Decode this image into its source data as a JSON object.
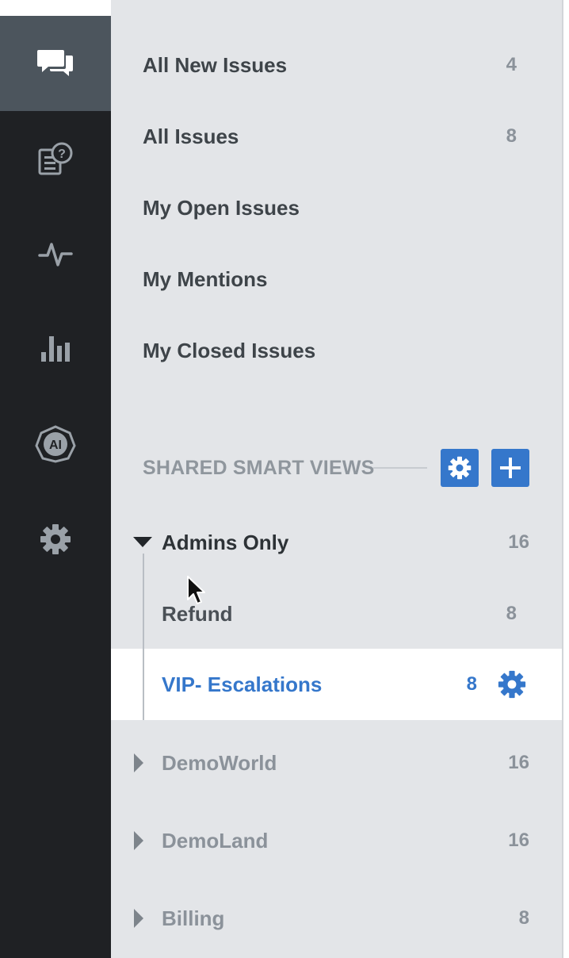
{
  "rail": {
    "items": [
      {
        "icon": "chat-bubbles-icon",
        "active": true
      },
      {
        "icon": "help-articles-icon",
        "active": false
      },
      {
        "icon": "activity-pulse-icon",
        "active": false
      },
      {
        "icon": "bar-chart-icon",
        "active": false
      },
      {
        "icon": "ai-badge-icon",
        "label": "AI",
        "active": false
      },
      {
        "icon": "gear-icon",
        "active": false
      }
    ]
  },
  "views": [
    {
      "label": "All New Issues",
      "count": "4"
    },
    {
      "label": "All Issues",
      "count": "8"
    },
    {
      "label": "My Open Issues",
      "count": ""
    },
    {
      "label": "My Mentions",
      "count": ""
    },
    {
      "label": "My Closed Issues",
      "count": ""
    }
  ],
  "shared": {
    "title": "SHARED SMART VIEWS",
    "groups": [
      {
        "label": "Admins Only",
        "count": "16",
        "expanded": true,
        "children": [
          {
            "label": "Refund",
            "count": "8",
            "selected": false
          },
          {
            "label": "VIP- Escalations",
            "count": "8",
            "selected": true
          }
        ]
      },
      {
        "label": "DemoWorld",
        "count": "16",
        "expanded": false
      },
      {
        "label": "DemoLand",
        "count": "16",
        "expanded": false
      },
      {
        "label": "Billing",
        "count": "8",
        "expanded": false
      }
    ]
  },
  "colors": {
    "accent": "#3577cb",
    "rail": "#1f2124",
    "rail_active": "#4c555d",
    "panel": "#e3e5e8",
    "muted": "#8b929a"
  }
}
